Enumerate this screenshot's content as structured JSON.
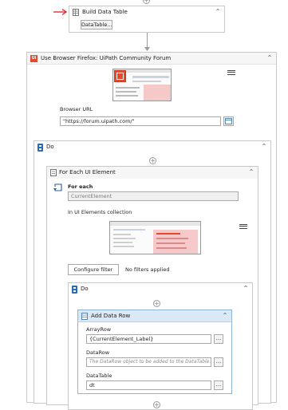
{
  "build_table": {
    "title": "Build Data Table",
    "button": "DataTable..."
  },
  "browser": {
    "title": "Use Browser Firefox: UiPath Community Forum",
    "url_label": "Browser URL",
    "url_value": "\"https://forum.uipath.com/\""
  },
  "do_outer": {
    "title": "Do"
  },
  "foreach": {
    "title": "For Each UI Element",
    "for_each_label": "For each",
    "item_value": "CurrentElement",
    "collection_label": "In UI Elements collection",
    "configure_button": "Configure filter",
    "filter_status": "No filters applied"
  },
  "do_inner": {
    "title": "Do"
  },
  "add_row": {
    "title": "Add Data Row",
    "array_row_label": "ArrayRow",
    "array_row_value": "{CurrentElement_Label}",
    "data_row_label": "DataRow",
    "data_row_placeholder": "The DataRow object to be added to the DataTable.",
    "data_table_label": "DataTable",
    "data_table_value": "dt"
  },
  "icons": {
    "ellipsis": "...",
    "collapse": "⌃",
    "plus": "+"
  },
  "colors": {
    "arrow": "#d9262c",
    "accent_blue": "#2b6cb0",
    "uipath_orange": "#e5492e",
    "add_row_header": "#dbe8f5"
  }
}
